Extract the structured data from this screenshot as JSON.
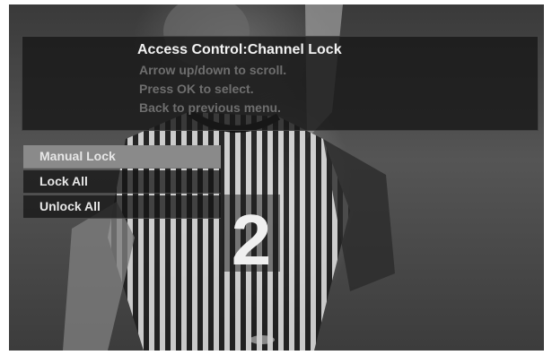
{
  "panel": {
    "title": "Access Control:Channel Lock",
    "hints": [
      "Arrow up/down to scroll.",
      "Press OK to select.",
      "Back to previous menu."
    ]
  },
  "menu": {
    "items": [
      {
        "label": "Manual Lock",
        "selected": true
      },
      {
        "label": "Lock All",
        "selected": false
      },
      {
        "label": "Unlock All",
        "selected": false
      }
    ]
  },
  "background": {
    "jersey_number": "2"
  }
}
